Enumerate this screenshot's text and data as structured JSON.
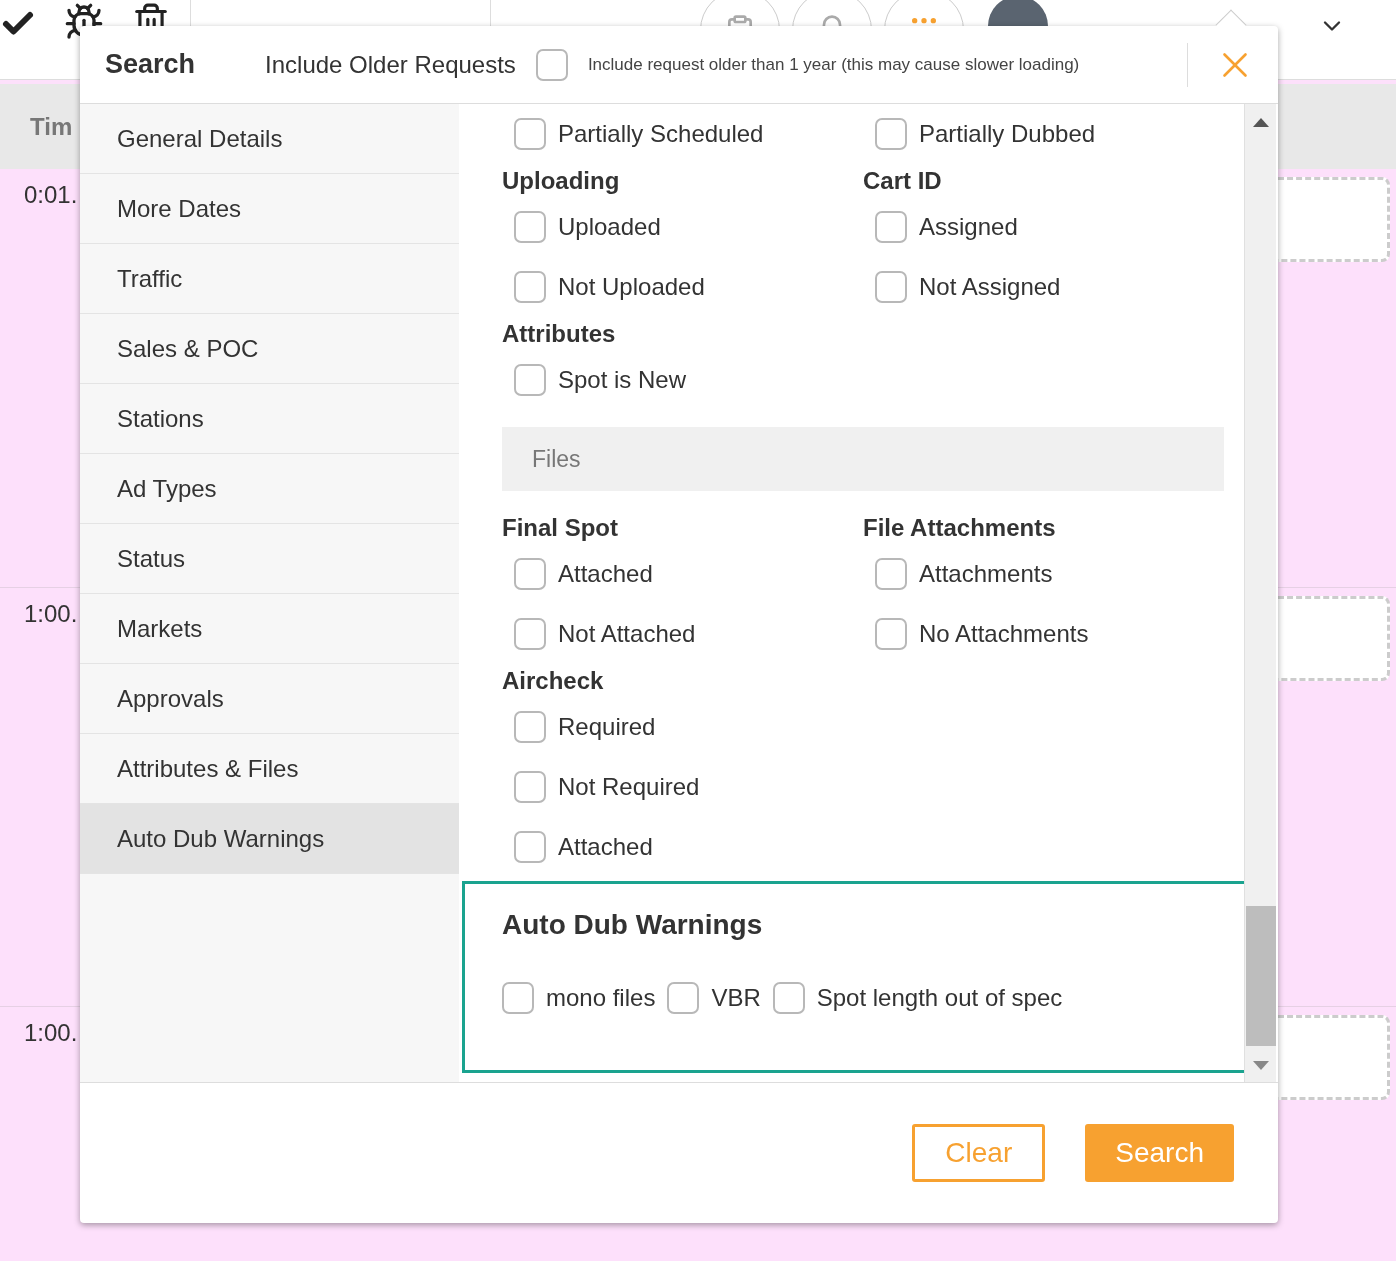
{
  "background": {
    "header": "Tim",
    "rows": [
      "0:01.",
      "1:00.",
      "1:00."
    ]
  },
  "dialog": {
    "title": "Search",
    "older_label": "Include Older Requests",
    "older_checked": false,
    "older_hint": "Include request older than 1 year (this may cause slower loading)",
    "sidebar": [
      {
        "label": "General Details",
        "selected": false
      },
      {
        "label": "More Dates",
        "selected": false
      },
      {
        "label": "Traffic",
        "selected": false
      },
      {
        "label": "Sales & POC",
        "selected": false
      },
      {
        "label": "Stations",
        "selected": false
      },
      {
        "label": "Ad Types",
        "selected": false
      },
      {
        "label": "Status",
        "selected": false
      },
      {
        "label": "Markets",
        "selected": false
      },
      {
        "label": "Approvals",
        "selected": false
      },
      {
        "label": "Attributes & Files",
        "selected": false
      },
      {
        "label": "Auto Dub Warnings",
        "selected": true
      }
    ],
    "sections": [
      {
        "kind": "columns",
        "columns": [
          {
            "options": [
              {
                "label": "Partially Scheduled",
                "checked": false
              }
            ]
          },
          {
            "options": [
              {
                "label": "Partially Dubbed",
                "checked": false
              }
            ]
          }
        ]
      },
      {
        "kind": "columns",
        "columns": [
          {
            "heading": "Uploading",
            "options": [
              {
                "label": "Uploaded",
                "checked": false
              },
              {
                "label": "Not Uploaded",
                "checked": false
              }
            ]
          },
          {
            "heading": "Cart ID",
            "options": [
              {
                "label": "Assigned",
                "checked": false
              },
              {
                "label": "Not Assigned",
                "checked": false
              }
            ]
          }
        ]
      },
      {
        "kind": "columns",
        "columns": [
          {
            "heading": "Attributes",
            "options": [
              {
                "label": "Spot is New",
                "checked": false
              }
            ]
          }
        ]
      },
      {
        "kind": "banner",
        "label": "Files"
      },
      {
        "kind": "columns",
        "columns": [
          {
            "heading": "Final Spot",
            "options": [
              {
                "label": "Attached",
                "checked": false
              },
              {
                "label": "Not Attached",
                "checked": false
              }
            ]
          },
          {
            "heading": "File Attachments",
            "options": [
              {
                "label": "Attachments",
                "checked": false
              },
              {
                "label": "No Attachments",
                "checked": false
              }
            ]
          }
        ]
      },
      {
        "kind": "columns",
        "columns": [
          {
            "heading": "Aircheck",
            "options": [
              {
                "label": "Required",
                "checked": false
              },
              {
                "label": "Not Required",
                "checked": false
              },
              {
                "label": "Attached",
                "checked": false
              }
            ]
          }
        ]
      },
      {
        "kind": "warnings",
        "heading": "Auto Dub Warnings",
        "options": [
          {
            "label": "mono files",
            "checked": false
          },
          {
            "label": "VBR",
            "checked": false
          },
          {
            "label": "Spot length out of spec",
            "checked": false
          }
        ]
      }
    ],
    "buttons": [
      {
        "label": "Clear",
        "kind": "outline"
      },
      {
        "label": "Search",
        "kind": "primary"
      }
    ]
  }
}
